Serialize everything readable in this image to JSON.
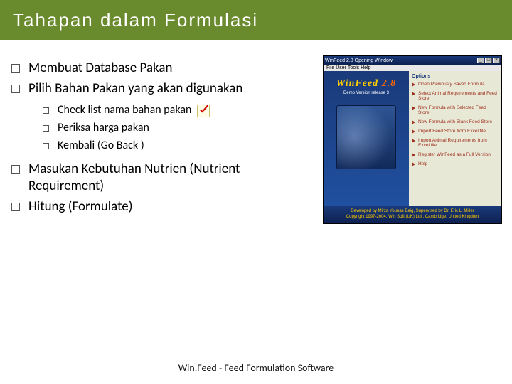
{
  "title": "Tahapan dalam Formulasi",
  "main_list": [
    "Membuat Database Pakan",
    "Pilih Bahan Pakan yang akan digunakan"
  ],
  "sub_list": [
    "Check list nama bahan pakan",
    "Periksa harga pakan",
    "Kembali (Go Back )"
  ],
  "main_list2": [
    "Masukan Kebutuhan Nutrien (Nutrient Requirement)",
    "Hitung (Formulate)"
  ],
  "footer": "Win.Feed - Feed Formulation Software",
  "app": {
    "titlebar": "WinFeed 2.8 Opening Window",
    "menu": "File  User  Tools  Help",
    "logo_a": "WinFeed",
    "logo_b": " 2.8",
    "demo": "Demo Version  release 3",
    "options_heading": "Options",
    "options": [
      "Open Previously Saved Formula",
      "Select Animal Requirements and Feed Store",
      "New Formula with Selected Feed Store",
      "New Formula with Blank Feed Store",
      "Import Feed Store from Excel file",
      "Import Animal Requirements from Excel file",
      "Register WinFeed as a Full Version",
      "Help"
    ],
    "footer1": "Developed by Mirza Younas Baig, Supervised by Dr. Eric L. Miller",
    "footer2": "Copyright 1997-2004, Win Soft (UK) Ltd., Cambridge, United Kingdom"
  }
}
